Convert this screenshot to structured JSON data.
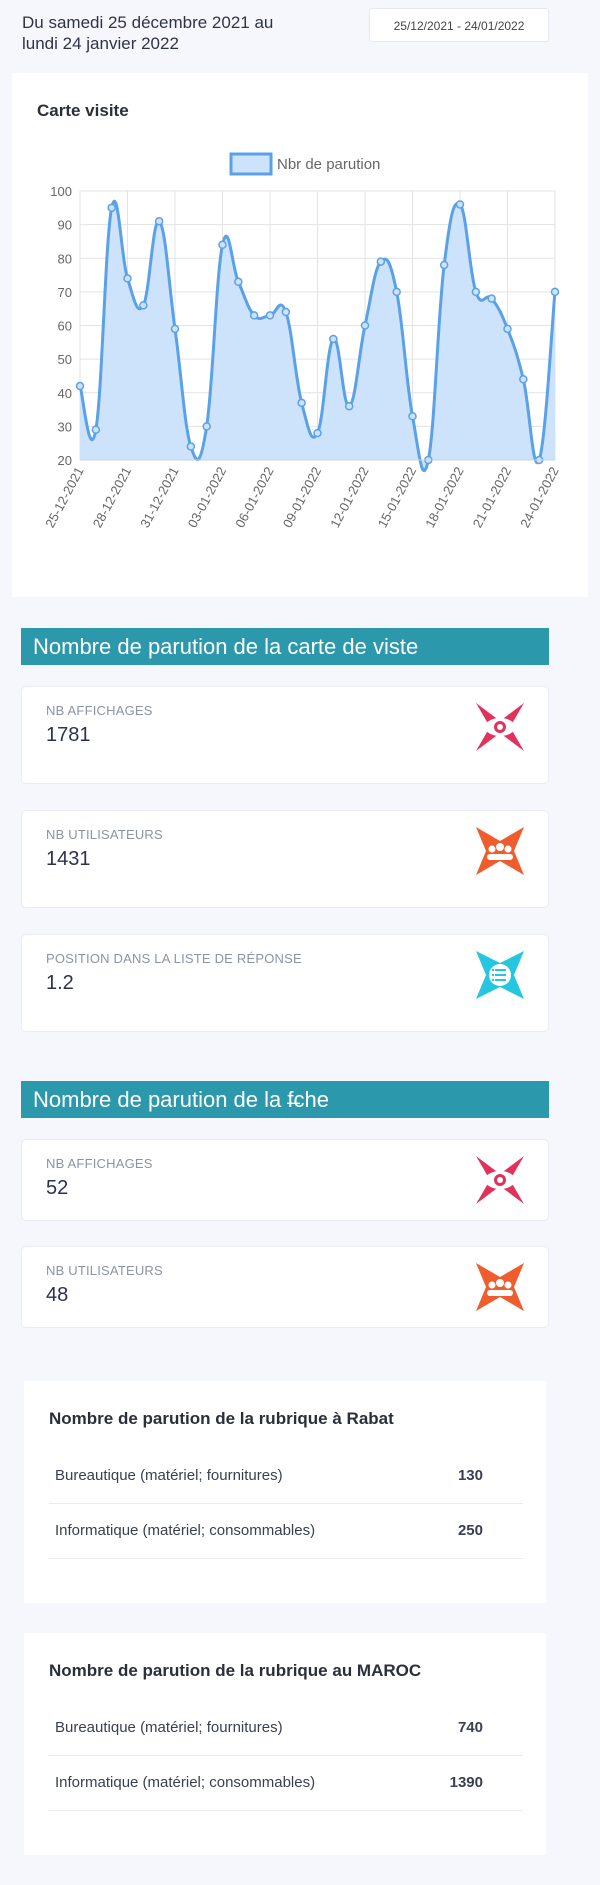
{
  "header": {
    "date_text": "Du samedi 25 décembre 2021 au lundi 24 janvier 2022",
    "date_picker_value": "25/12/2021 - 24/01/2022"
  },
  "chart_card": {
    "title": "Carte visite"
  },
  "chart_data": {
    "type": "area",
    "legend_position": "top",
    "series": [
      {
        "name": "Nbr de parution",
        "color": "#5aa1e8",
        "fill": "#cde3fb",
        "values": [
          42,
          29,
          95,
          74,
          66,
          91,
          59,
          24,
          30,
          84,
          73,
          63,
          63,
          64,
          37,
          28,
          56,
          36,
          60,
          79,
          70,
          33,
          20,
          78,
          96,
          70,
          68,
          59,
          44,
          20,
          70
        ]
      }
    ],
    "x": [
      "25-12-2021",
      "26-12-2021",
      "27-12-2021",
      "28-12-2021",
      "29-12-2021",
      "30-12-2021",
      "31-12-2021",
      "01-01-2022",
      "02-01-2022",
      "03-01-2022",
      "04-01-2022",
      "05-01-2022",
      "06-01-2022",
      "07-01-2022",
      "08-01-2022",
      "09-01-2022",
      "10-01-2022",
      "11-01-2022",
      "12-01-2022",
      "13-01-2022",
      "14-01-2022",
      "15-01-2022",
      "16-01-2022",
      "17-01-2022",
      "18-01-2022",
      "19-01-2022",
      "20-01-2022",
      "21-01-2022",
      "22-01-2022",
      "23-01-2022",
      "24-01-2022"
    ],
    "x_tick_labels": [
      "25-12-2021",
      "28-12-2021",
      "31-12-2021",
      "03-01-2022",
      "06-01-2022",
      "09-01-2022",
      "12-01-2022",
      "15-01-2022",
      "18-01-2022",
      "21-01-2022",
      "24-01-2022"
    ],
    "y_ticks": [
      100,
      90,
      80,
      70,
      60,
      50,
      40,
      30,
      20
    ],
    "ylim": [
      20,
      100
    ],
    "grid": true
  },
  "section1": {
    "title": "Nombre de parution de la carte de viste",
    "stats": [
      {
        "label": "NB AFFICHAGES",
        "value": "1781",
        "icon": "eye-icon",
        "color": "#e2315a"
      },
      {
        "label": "NB UTILISATEURS",
        "value": "1431",
        "icon": "users-icon",
        "color": "#ef5d2e"
      },
      {
        "label": "POSITION DANS LA LISTE DE RÉPONSE",
        "value": "1.2",
        "icon": "list-icon",
        "color": "#26c6e0"
      }
    ]
  },
  "section2": {
    "title": "Nombre de parution de la f̶che",
    "stats": [
      {
        "label": "NB AFFICHAGES",
        "value": "52",
        "icon": "eye-icon",
        "color": "#e2315a"
      },
      {
        "label": "NB UTILISATEURS",
        "value": "48",
        "icon": "users-icon",
        "color": "#ef5d2e"
      }
    ]
  },
  "table_rabat": {
    "title": "Nombre de parution de la rubrique à Rabat",
    "rows": [
      {
        "label": "Bureautique (matériel; fournitures)",
        "value": "130"
      },
      {
        "label": "Informatique (matériel; consommables)",
        "value": "250"
      }
    ]
  },
  "table_maroc": {
    "title": "Nombre de parution de la rubrique au MAROC",
    "rows": [
      {
        "label": "Bureautique (matériel; fournitures)",
        "value": "740"
      },
      {
        "label": "Informatique (matériel; consommables)",
        "value": "1390"
      }
    ]
  }
}
